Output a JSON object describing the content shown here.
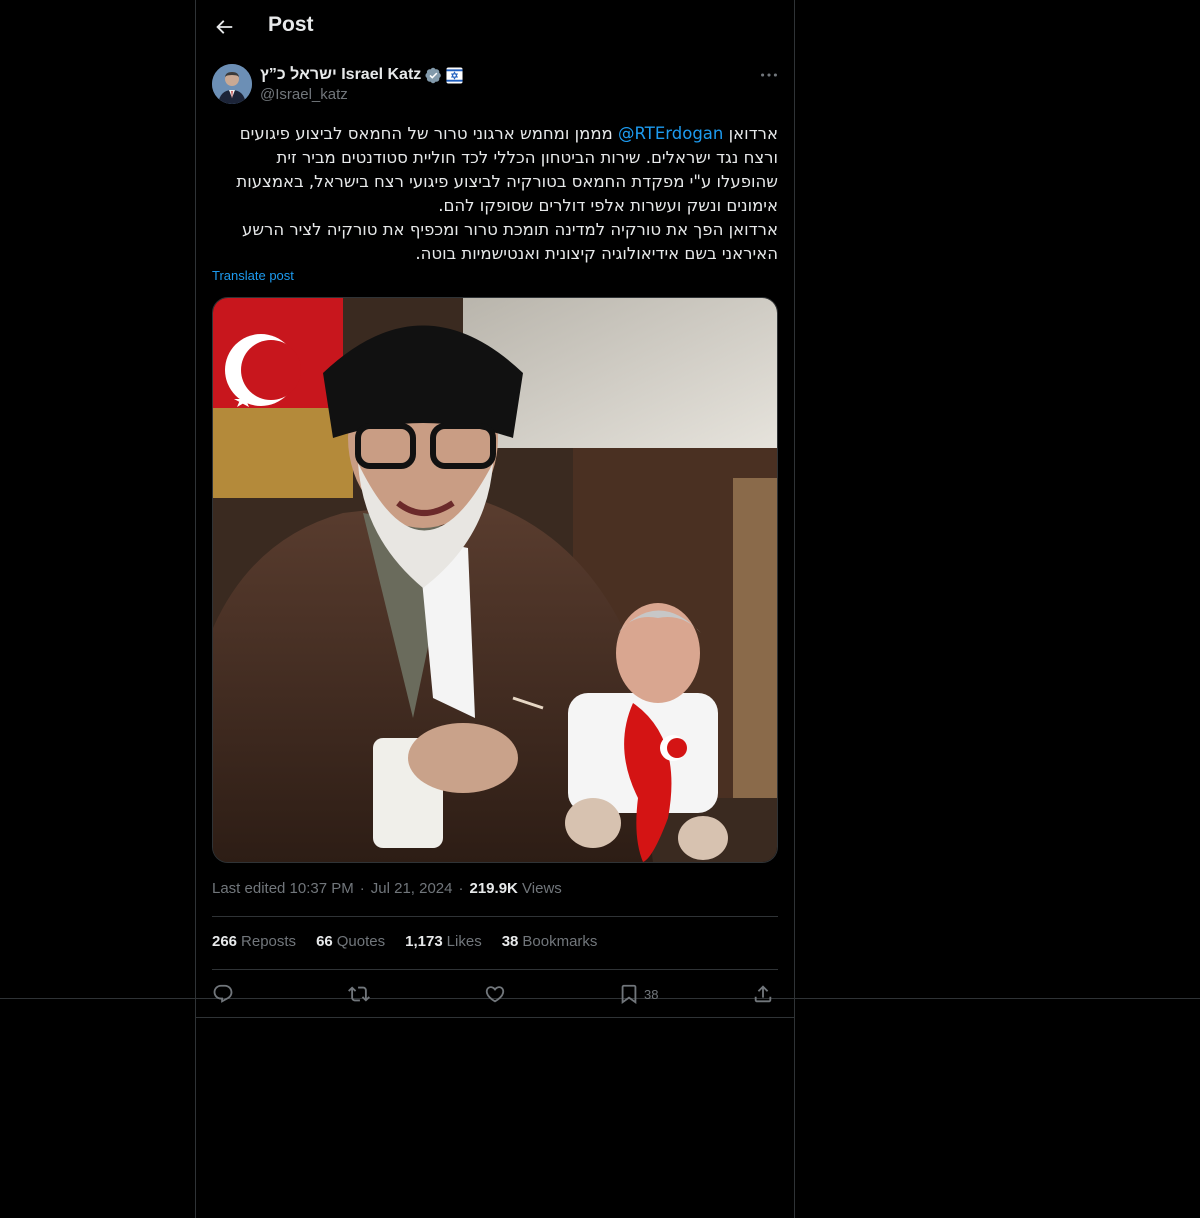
{
  "header": {
    "title": "Post"
  },
  "author": {
    "display_name": "ישראל כ”ץ Israel Katz",
    "handle": "@Israel_katz",
    "verified_icon": "verified-badge-icon",
    "affiliate_icon": "israel-flag-icon"
  },
  "tweet": {
    "mention": "@RTErdogan",
    "line1_prefix": "ארדואן ",
    "line1_suffix": " מממן ומחמש ארגוני טרור של החמאס לביצוע פיגועים ורצח נגד ישראלים. שירות הביטחון הכללי לכד חוליית סטודנטים מביר זית שהופעלו ע\"י מפקדת החמאס בטורקיה לביצוע פיגועי רצח בישראל, באמצעות אימונים ונשק ועשרות אלפי דולרים שסופקו להם.",
    "paragraph2": "ארדואן הפך את טורקיה למדינה תומכת טרור ומכפיף את טורקיה לציר הרשע האיראני בשם אידיאולוגיה קיצונית ואנטישמיות בוטה.",
    "translate_label": "Translate post"
  },
  "meta": {
    "edited": "Last edited 10:37 PM",
    "dot1": "·",
    "date": "Jul 21, 2024",
    "dot2": "·",
    "views_count": "219.9K",
    "views_label": "Views"
  },
  "stats": {
    "reposts_count": "266",
    "reposts_label": "Reposts",
    "quotes_count": "66",
    "quotes_label": "Quotes",
    "likes_count": "1,173",
    "likes_label": "Likes",
    "bookmarks_count": "38",
    "bookmarks_label": "Bookmarks"
  },
  "actions": {
    "bookmark_count": "38"
  },
  "colors": {
    "background": "#000000",
    "border": "#2f3336",
    "text": "#e7e9ea",
    "muted": "#71767b",
    "accent": "#1d9bf0"
  }
}
